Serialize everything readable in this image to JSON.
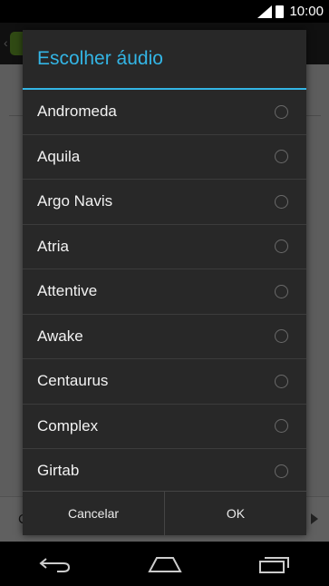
{
  "status_bar": {
    "time": "10:00"
  },
  "background": {
    "bottom_text": "C"
  },
  "dialog": {
    "title": "Escolher áudio",
    "options": [
      {
        "label": "Andromeda",
        "selected": false
      },
      {
        "label": "Aquila",
        "selected": false
      },
      {
        "label": "Argo Navis",
        "selected": false
      },
      {
        "label": "Atria",
        "selected": false
      },
      {
        "label": "Attentive",
        "selected": false
      },
      {
        "label": "Awake",
        "selected": false
      },
      {
        "label": "Centaurus",
        "selected": false
      },
      {
        "label": "Complex",
        "selected": false
      },
      {
        "label": "Girtab",
        "selected": false
      }
    ],
    "cancel_label": "Cancelar",
    "ok_label": "OK"
  },
  "nav_bar": {
    "icons": [
      "back-icon",
      "home-icon",
      "recents-icon"
    ]
  },
  "colors": {
    "accent": "#33b5e5",
    "dialog_bg": "#282828"
  }
}
